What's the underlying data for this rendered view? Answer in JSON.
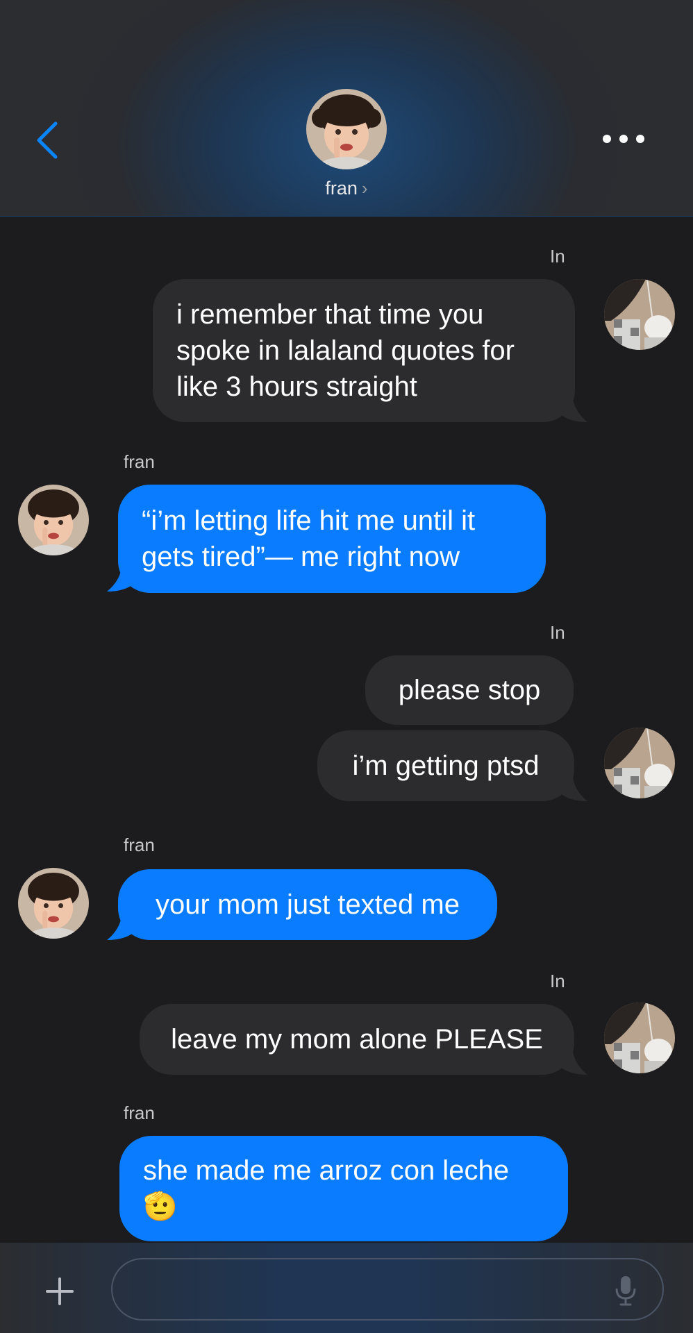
{
  "header": {
    "contact_name": "fran",
    "chevron": "›"
  },
  "icons": {
    "back": "chevron-left-icon",
    "more": "ellipsis-icon",
    "plus": "plus-icon",
    "mic": "microphone-icon"
  },
  "colors": {
    "accent": "#0a7cff",
    "incoming_bubble": "#0a7cff",
    "outgoing_bubble": "#2c2c2e",
    "background": "#1c1c1e"
  },
  "messages": [
    {
      "sender": "In",
      "direction": "outgoing",
      "lines": [
        "i remember that time you",
        "spoke in lalaland quotes for",
        "like 3 hours straight"
      ]
    },
    {
      "sender": "fran",
      "direction": "incoming",
      "lines": [
        "“i’m letting life hit me until it",
        "gets tired”— me right now"
      ]
    },
    {
      "sender": "In",
      "direction": "outgoing",
      "lines": [
        "please stop"
      ]
    },
    {
      "sender": "In",
      "direction": "outgoing",
      "lines": [
        "i’m getting ptsd"
      ]
    },
    {
      "sender": "fran",
      "direction": "incoming",
      "lines": [
        "your mom just texted me"
      ]
    },
    {
      "sender": "In",
      "direction": "outgoing",
      "lines": [
        "leave my mom alone PLEASE"
      ]
    },
    {
      "sender": "fran",
      "direction": "incoming",
      "lines": [
        "she made me arroz con leche",
        "🫡"
      ]
    }
  ],
  "composer": {
    "value": "",
    "placeholder": ""
  }
}
